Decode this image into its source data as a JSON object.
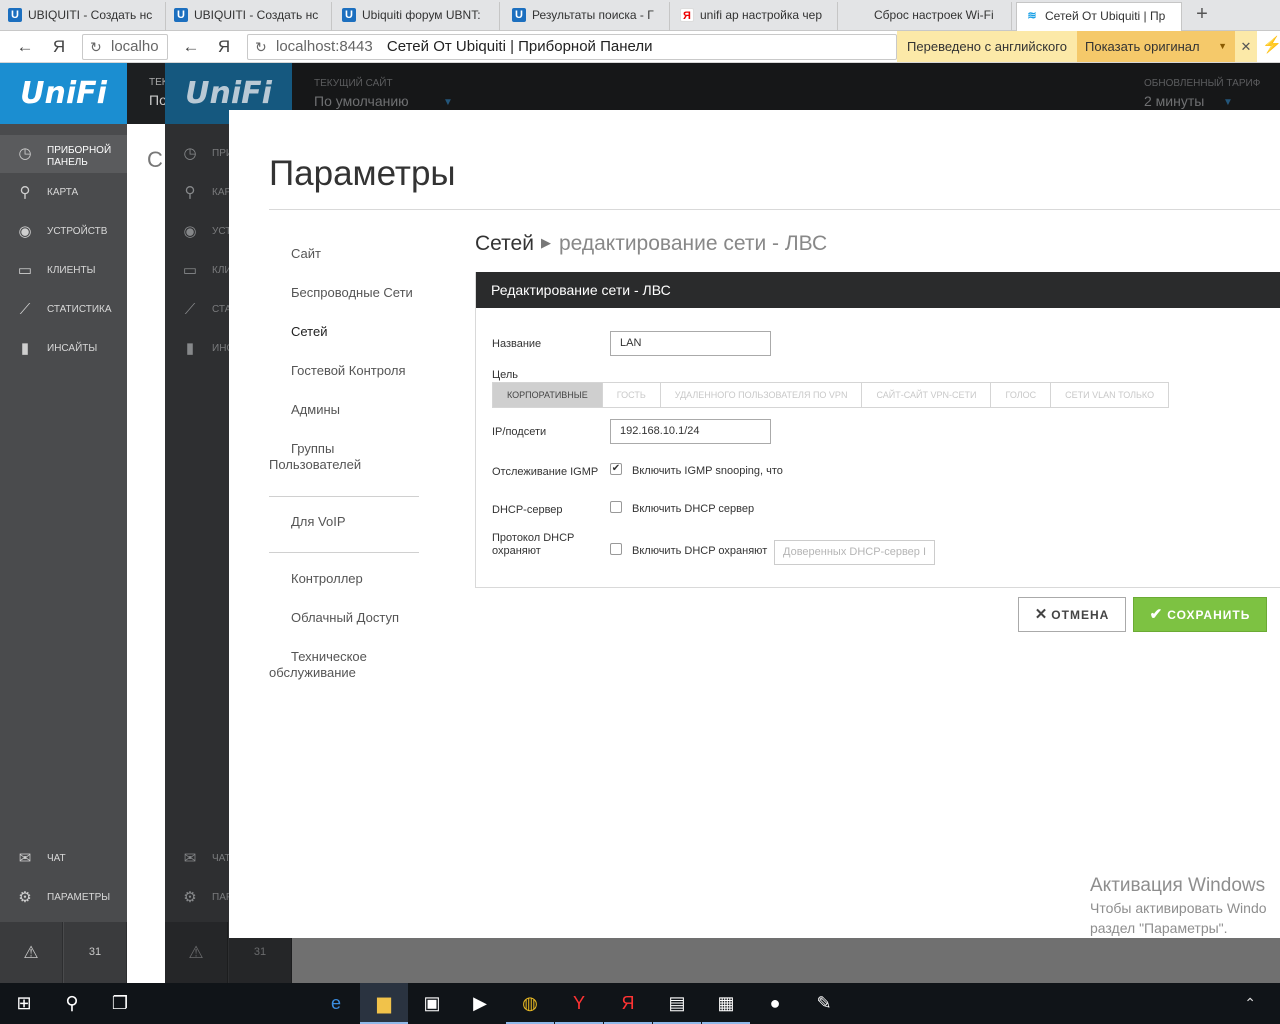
{
  "browser": {
    "tabs": [
      {
        "label": "UBIQUITI - Создать нс",
        "favicon": "U",
        "kind": "ubiquiti"
      },
      {
        "label": "UBIQUITI - Создать нс",
        "favicon": "U",
        "kind": "ubiquiti"
      },
      {
        "label": "Ubiquiti форум UBNT:",
        "favicon": "U",
        "kind": "ubiquiti"
      },
      {
        "label": "Результаты поиска - Г",
        "favicon": "U",
        "kind": "ubiquiti"
      },
      {
        "label": "unifi ap настройка чер",
        "favicon": "Я",
        "kind": "yandex"
      },
      {
        "label": "Сброс настроек Wi-Fi",
        "favicon": "",
        "kind": "blank"
      },
      {
        "label": "Сетей От Ubiquiti | Пр",
        "favicon": "≋",
        "kind": "wifi",
        "active": true
      }
    ],
    "new_tab": "+",
    "back_behind": {
      "host": "localho",
      "yandex": "Я"
    },
    "address": {
      "host": "localhost:8443",
      "title": "Сетей От Ubiquiti | Приборной Панели",
      "yandex": "Я"
    },
    "translate": {
      "status": "Переведено с английского",
      "show_original": "Показать оригинал",
      "close": "✕"
    },
    "colors": {
      "translate_bar": "#fce9a8",
      "show_original": "#f5c96a"
    }
  },
  "unifi": {
    "logo": "UniFi",
    "back_topbar_label": "ТЕК",
    "back_topbar_value": "По",
    "back_main_title": "С",
    "header": {
      "site_label": "Текущий сайт",
      "site_value": "По умолчанию",
      "plan_label": "Обновленный тариф",
      "plan_value": "2 минуты"
    },
    "nav": [
      {
        "label": "Приборной панель",
        "icon": "dashboard-icon",
        "glyph": "◷"
      },
      {
        "label": "Карта",
        "icon": "map-pin-icon",
        "glyph": "⚲"
      },
      {
        "label": "Устройств",
        "icon": "devices-icon",
        "glyph": "◉"
      },
      {
        "label": "Клиенты",
        "icon": "clients-icon",
        "glyph": "▭"
      },
      {
        "label": "Статистика",
        "icon": "stats-icon",
        "glyph": "⟋"
      },
      {
        "label": "Инсайты",
        "icon": "insights-icon",
        "glyph": "▮"
      }
    ],
    "nav_bottom": [
      {
        "label": "Чат",
        "icon": "chat-icon",
        "glyph": "✉"
      },
      {
        "label": "Параметры",
        "icon": "settings-icon",
        "glyph": "⚙"
      }
    ],
    "footer": {
      "alerts_glyph": "⚠",
      "calendar_text": "31"
    },
    "colors": {
      "accent": "#1b8ed1",
      "save": "#7dc242"
    }
  },
  "settings": {
    "title": "Параметры",
    "menu": [
      {
        "label": "Сайт"
      },
      {
        "label": "Беспроводные Сети"
      },
      {
        "label": "Сетей",
        "active": true
      },
      {
        "label": "Гостевой Контроля"
      },
      {
        "label": "Админы"
      },
      {
        "label": "Группы Пользователей"
      },
      {
        "label": "Для VoIP"
      },
      {
        "label": "Контроллер"
      },
      {
        "label": "Облачный Доступ"
      },
      {
        "label": "Техническое обслуживание"
      }
    ],
    "breadcrumb": {
      "root": "Сетей",
      "current": "редактирование сети - ЛВС"
    },
    "panel_title": "Редактирование сети - ЛВС",
    "form": {
      "name_label": "Название",
      "name_value": "LAN",
      "purpose_label": "Цель",
      "purpose_options": [
        {
          "label": "Корпоративные",
          "selected": true
        },
        {
          "label": "Гость"
        },
        {
          "label": "Удаленного пользователя по VPN"
        },
        {
          "label": "Сайт-сайт VPN-сети"
        },
        {
          "label": "Голос"
        },
        {
          "label": "Сети VLAN только"
        }
      ],
      "ip_label": "IP/подсети",
      "ip_value": "192.168.10.1/24",
      "igmp_label": "Отслеживание IGMP",
      "igmp_checkbox": "Включить IGMP snooping, что",
      "igmp_checked": true,
      "dhcp_label": "DHCP-сервер",
      "dhcp_checkbox": "Включить DHCP сервер",
      "dhcp_checked": false,
      "guard_label": "Протокол DHCP охраняют",
      "guard_checkbox": "Включить DHCP охраняют",
      "guard_checked": false,
      "guard_placeholder": "Доверенных DHCP-сервер I"
    },
    "buttons": {
      "cancel": "ОТМЕНА",
      "save": "СОХРАНИТЬ"
    }
  },
  "watermark": {
    "title": "Активация Windows",
    "line1": "Чтобы активировать Windo",
    "line2": "раздел \"Параметры\"."
  },
  "taskbar": {
    "items": [
      {
        "name": "start-button",
        "glyph": "⊞"
      },
      {
        "name": "search-button",
        "glyph": "⚲"
      },
      {
        "name": "task-view-button",
        "glyph": "❐"
      },
      {
        "name": "edge-icon",
        "glyph": "e"
      },
      {
        "name": "explorer-icon",
        "glyph": "▆"
      },
      {
        "name": "store-icon",
        "glyph": "▣"
      },
      {
        "name": "media-player-icon",
        "glyph": "▶"
      },
      {
        "name": "chrome-icon",
        "glyph": "◍"
      },
      {
        "name": "yandex-browser-icon",
        "glyph": "Y"
      },
      {
        "name": "yandex-icon",
        "glyph": "Я"
      },
      {
        "name": "network-app-icon",
        "glyph": "▤"
      },
      {
        "name": "remote-desktop-icon",
        "glyph": "▦"
      },
      {
        "name": "unifi-controller-icon",
        "glyph": "●"
      },
      {
        "name": "paint-icon",
        "glyph": "✎"
      }
    ],
    "tray_chevron": "⌃"
  }
}
